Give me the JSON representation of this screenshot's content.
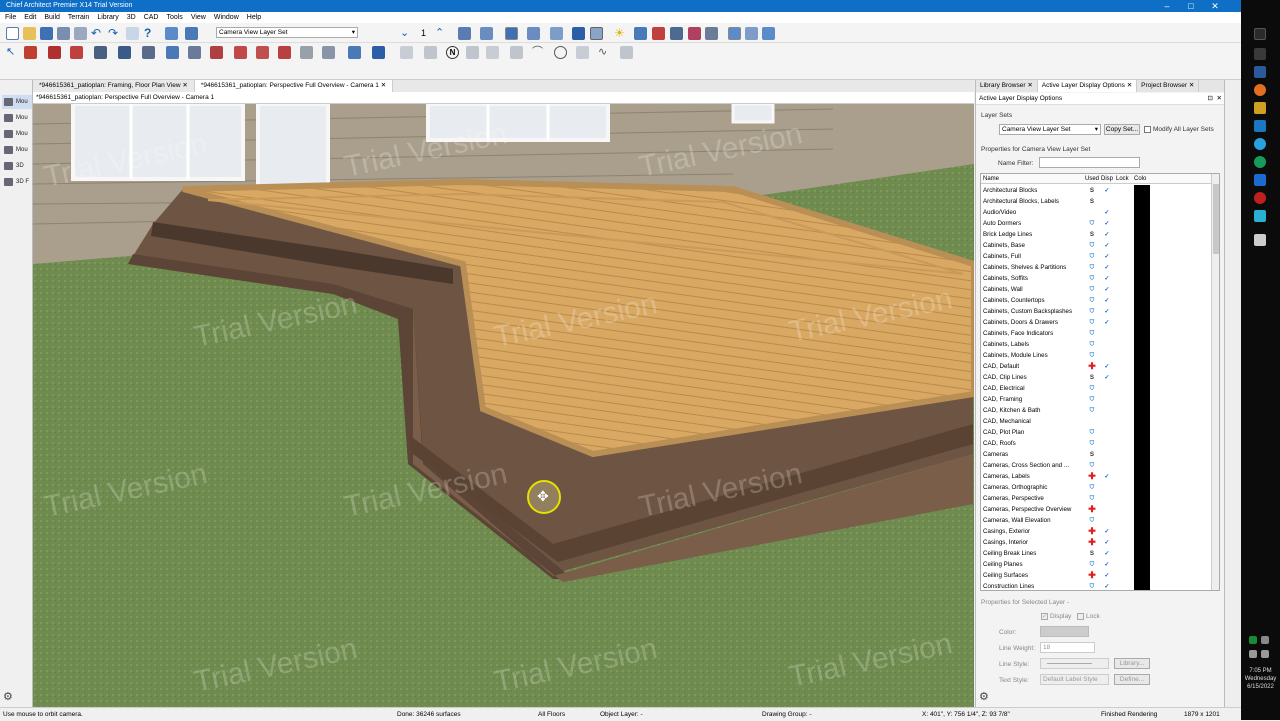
{
  "window": {
    "title": "Chief Architect Premier X14 Trial Version",
    "minimize": "–",
    "maximize": "□",
    "close": "✕"
  },
  "menu": [
    "File",
    "Edit",
    "Build",
    "Terrain",
    "Library",
    "3D",
    "CAD",
    "Tools",
    "View",
    "Window",
    "Help"
  ],
  "toolbar": {
    "layer_set": "Camera View Layer Set",
    "layer_number": "1"
  },
  "left_panel": [
    "Mou",
    "Mou",
    "Mou",
    "Mou",
    "3D",
    "3D F"
  ],
  "doc_tabs": [
    {
      "label": "*946615361_patioplan: Framing, Floor Plan View",
      "close": "✕"
    },
    {
      "label": "*946615361_patioplan: Perspective Full Overview - Camera 1",
      "close": "✕"
    }
  ],
  "view_header": "*946615361_patioplan: Perspective Full Overview - Camera 1",
  "watermark": "Trial Version",
  "right_panel": {
    "tabs": [
      {
        "label": "Library Browser",
        "close": "✕"
      },
      {
        "label": "Active Layer Display Options",
        "close": "✕"
      },
      {
        "label": "Project Browser",
        "close": "✕"
      }
    ],
    "title": "Active Layer Display Options",
    "layer_sets_label": "Layer Sets",
    "layer_set_value": "Camera View Layer Set",
    "copy_set_button": "Copy Set...",
    "modify_all_label": "Modify All Layer Sets",
    "properties_label": "Properties for Camera View Layer Set",
    "name_filter_label": "Name Filter:",
    "name_filter_value": "",
    "columns": {
      "name": "Name",
      "used": "Used",
      "disp": "Disp",
      "lock": "Lock",
      "color": "Colo"
    },
    "rows": [
      {
        "name": "Architectural Blocks",
        "used": "S",
        "disp": "✓"
      },
      {
        "name": "Architectural Blocks, Labels",
        "used": "S",
        "disp": ""
      },
      {
        "name": "Audio/Video",
        "used": "",
        "disp": "✓"
      },
      {
        "name": "Auto Dormers",
        "used": "i",
        "disp": "✓"
      },
      {
        "name": "Brick Ledge Lines",
        "used": "S",
        "disp": "✓"
      },
      {
        "name": "Cabinets,  Base",
        "used": "i",
        "disp": "✓"
      },
      {
        "name": "Cabinets,  Full",
        "used": "i",
        "disp": "✓"
      },
      {
        "name": "Cabinets,  Shelves & Partitions",
        "used": "i",
        "disp": "✓"
      },
      {
        "name": "Cabinets,  Soffits",
        "used": "i",
        "disp": "✓"
      },
      {
        "name": "Cabinets,  Wall",
        "used": "i",
        "disp": "✓"
      },
      {
        "name": "Cabinets, Countertops",
        "used": "i",
        "disp": "✓"
      },
      {
        "name": "Cabinets, Custom Backsplashes",
        "used": "i",
        "disp": "✓"
      },
      {
        "name": "Cabinets, Doors & Drawers",
        "used": "i",
        "disp": "✓"
      },
      {
        "name": "Cabinets, Face Indicators",
        "used": "i",
        "disp": ""
      },
      {
        "name": "Cabinets, Labels",
        "used": "i",
        "disp": ""
      },
      {
        "name": "Cabinets, Module Lines",
        "used": "i",
        "disp": ""
      },
      {
        "name": "CAD,  Default",
        "used": "+",
        "disp": "✓"
      },
      {
        "name": "CAD, Clip Lines",
        "used": "S",
        "disp": "✓"
      },
      {
        "name": "CAD, Electrical",
        "used": "i",
        "disp": ""
      },
      {
        "name": "CAD, Framing",
        "used": "i",
        "disp": ""
      },
      {
        "name": "CAD, Kitchen & Bath",
        "used": "i",
        "disp": ""
      },
      {
        "name": "CAD, Mechanical",
        "used": "",
        "disp": ""
      },
      {
        "name": "CAD, Plot Plan",
        "used": "i",
        "disp": ""
      },
      {
        "name": "CAD, Roofs",
        "used": "i",
        "disp": ""
      },
      {
        "name": "Cameras",
        "used": "S",
        "disp": ""
      },
      {
        "name": "Cameras, Cross Section and ...",
        "used": "i",
        "disp": ""
      },
      {
        "name": "Cameras, Labels",
        "used": "+",
        "disp": "✓"
      },
      {
        "name": "Cameras, Orthographic",
        "used": "i",
        "disp": ""
      },
      {
        "name": "Cameras, Perspective",
        "used": "i",
        "disp": ""
      },
      {
        "name": "Cameras, Perspective Overview",
        "used": "+",
        "disp": ""
      },
      {
        "name": "Cameras, Wall Elevation",
        "used": "i",
        "disp": ""
      },
      {
        "name": "Casings, Exterior",
        "used": "+",
        "disp": "✓"
      },
      {
        "name": "Casings, Interior",
        "used": "+",
        "disp": "✓"
      },
      {
        "name": "Ceiling Break Lines",
        "used": "S",
        "disp": "✓"
      },
      {
        "name": "Ceiling Planes",
        "used": "i",
        "disp": "✓"
      },
      {
        "name": "Ceiling Surfaces",
        "used": "+",
        "disp": "✓"
      },
      {
        "name": "Construction Lines",
        "used": "i",
        "disp": "✓"
      }
    ],
    "selected": {
      "title": "Properties for Selected Layer -",
      "display": "Display",
      "lock": "Lock",
      "color": "Color:",
      "line_weight_label": "Line Weight:",
      "line_weight_value": "18",
      "line_style_label": "Line Style:",
      "library_button": "Library...",
      "text_style_label": "Text Style:",
      "text_style_value": "Default Label Style",
      "define_button": "Define..."
    }
  },
  "status": {
    "hint": "Use mouse to orbit camera.",
    "done": "Done:  36246 surfaces",
    "floors": "All Floors",
    "object_layer": "Object Layer: -",
    "drawing_group": "Drawing Group: -",
    "coords": "X: 401\",  Y: 756 1/4\",  Z: 93 7/8\"",
    "rendering": "Finished Rendering",
    "size": "1879 x 1201"
  },
  "taskbar": {
    "time": "7:05 PM",
    "day": "Wednesday",
    "date": "6/15/2022"
  },
  "colors": {
    "accent": "#0f6fc6",
    "grass": "#6f8b4f",
    "deck_top": "#d6a35e",
    "deck_side": "#6e5442"
  }
}
